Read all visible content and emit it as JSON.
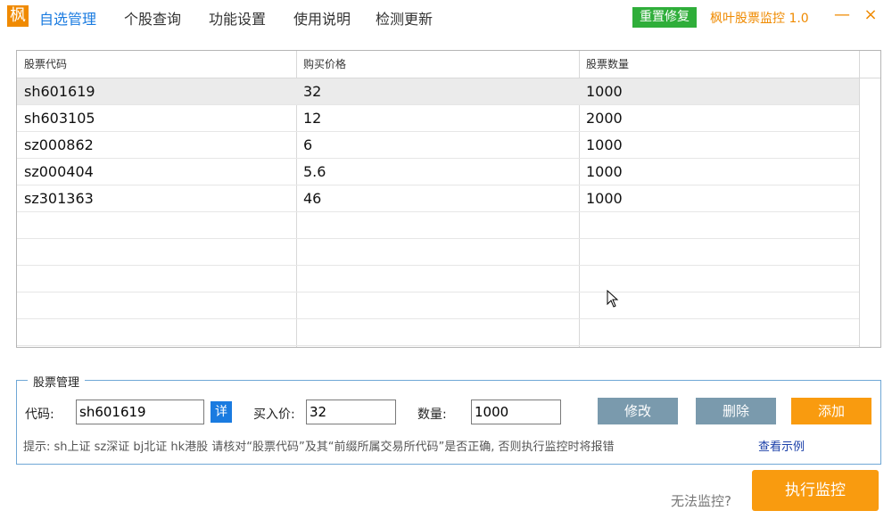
{
  "logo": "枫",
  "menu": [
    "自选管理",
    "个股查询",
    "功能设置",
    "使用说明",
    "检测更新"
  ],
  "reset_button": "重置修复",
  "app_title": "枫叶股票监控 1.0",
  "window": {
    "minimize": "—",
    "close": "×"
  },
  "table": {
    "headers": [
      "股票代码",
      "购买价格",
      "股票数量"
    ],
    "rows": [
      [
        "sh601619",
        "32",
        "1000"
      ],
      [
        "sh603105",
        "12",
        "2000"
      ],
      [
        "sz000862",
        "6",
        "1000"
      ],
      [
        "sz000404",
        "5.6",
        "1000"
      ],
      [
        "sz301363",
        "46",
        "1000"
      ]
    ]
  },
  "manage": {
    "legend": "股票管理",
    "code_label": "代码:",
    "code_value": "sh601619",
    "detail_button": "详",
    "price_label": "买入价:",
    "price_value": "32",
    "qty_label": "数量:",
    "qty_value": "1000",
    "edit_button": "修改",
    "delete_button": "删除",
    "add_button": "添加",
    "hint": "提示: sh上证 sz深证 bj北证 hk港股  请核对“股票代码”及其“前缀所属交易所代码”是否正确, 否则执行监控时将报错",
    "example_link": "查看示例"
  },
  "footer": {
    "cant_monitor": "无法监控?",
    "run_button": "执行监控"
  },
  "colors": {
    "accent": "#1a7be0",
    "orange": "#f99b0f",
    "green": "#2fae3a",
    "gray_button": "#7a9aad"
  }
}
